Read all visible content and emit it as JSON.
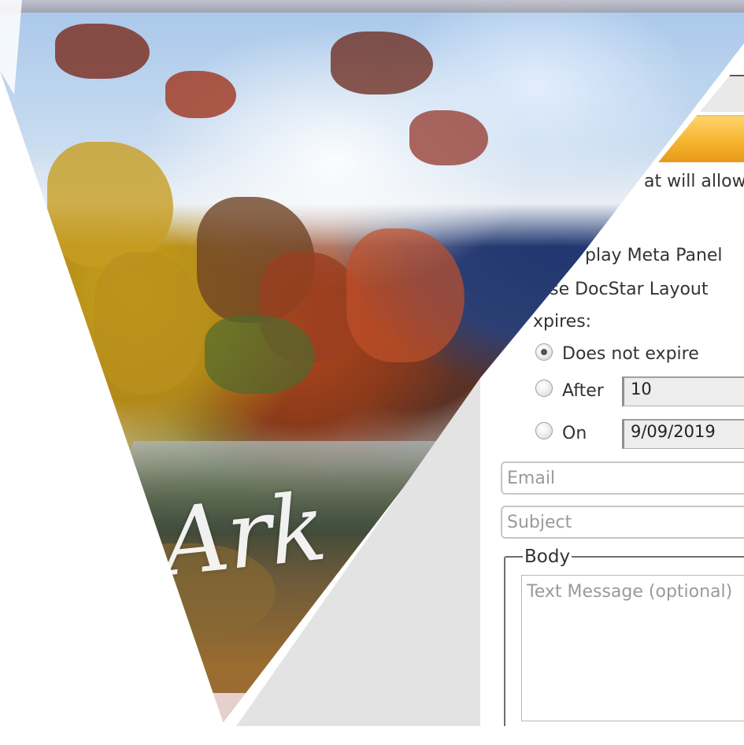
{
  "dialog": {
    "intro_fragment": "at will allow",
    "options": {
      "display_meta_panel": "play Meta Panel",
      "use_docstar_layout": "Use DocStar Layout"
    },
    "expires": {
      "label": "xpires:",
      "does_not_expire": "Does not expire",
      "after": {
        "label": "After",
        "value": "10"
      },
      "on": {
        "label": "On",
        "value": "9/09/2019"
      },
      "selected": "does_not_expire"
    },
    "email_placeholder": "Email",
    "subject_placeholder": "Subject",
    "body": {
      "legend": "Body",
      "placeholder": "Text Message (optional)"
    },
    "accent_color": "#f6b42e"
  },
  "background": {
    "signature_text": "Ark"
  }
}
